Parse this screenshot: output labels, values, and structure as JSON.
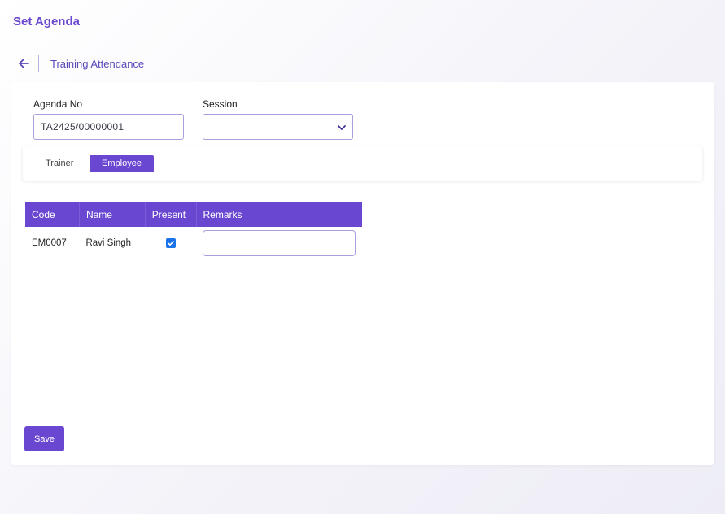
{
  "page": {
    "title": "Set Agenda"
  },
  "breadcrumb": {
    "back_icon": "arrow-left-icon",
    "title": "Training Attendance"
  },
  "form": {
    "agenda_no": {
      "label": "Agenda No",
      "value": "TA2425/00000001"
    },
    "session": {
      "label": "Session",
      "value": "",
      "icon": "chevron-down-icon"
    }
  },
  "toggle": {
    "options": [
      "Trainer",
      "Employee"
    ],
    "selected": "Employee"
  },
  "table": {
    "columns": [
      "Code",
      "Name",
      "Present",
      "Remarks"
    ],
    "rows": [
      {
        "code": "EM0007",
        "name": "Ravi Singh",
        "present": true,
        "remarks": ""
      }
    ]
  },
  "actions": {
    "save_label": "Save"
  },
  "colors": {
    "accent": "#6a47d1",
    "checkbox": "#1a73e8",
    "input_border": "#a99ee0"
  }
}
